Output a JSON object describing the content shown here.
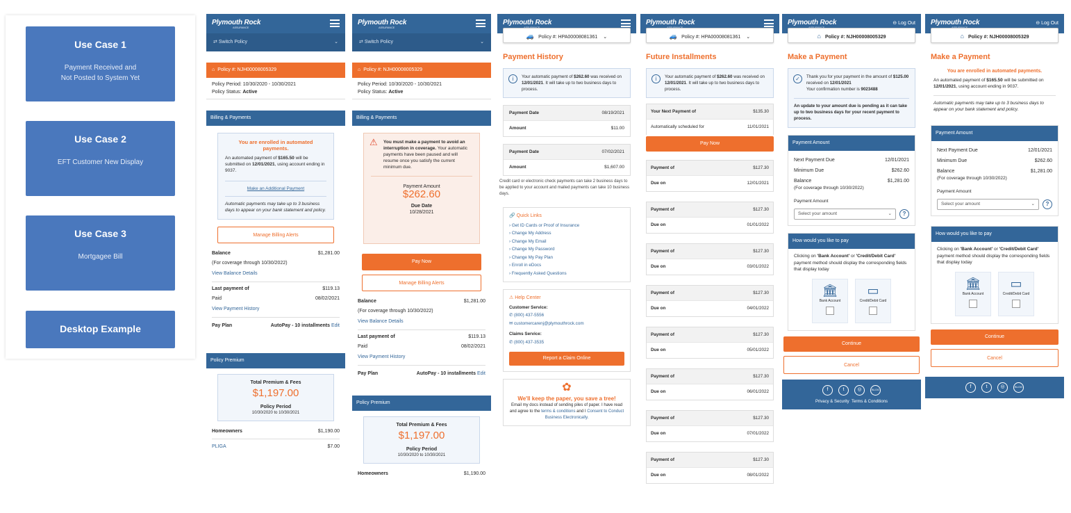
{
  "use_cases": [
    {
      "title": "Use Case 1",
      "desc1": "Payment Received and",
      "desc2": "Not Posted to System Yet"
    },
    {
      "title": "Use Case 2",
      "desc1": "EFT Customer New Display",
      "desc2": ""
    },
    {
      "title": "Use Case 3",
      "desc1": "Mortgagee Bill",
      "desc2": ""
    },
    {
      "title": "Desktop Example",
      "desc1": "",
      "desc2": ""
    }
  ],
  "common": {
    "logo": "Plymouth Rock",
    "logo_sub": "ASSURANCE",
    "switch_policy": "Switch Policy",
    "policy_number": "Policy #: NJH00008005329",
    "policy_period_label": "Policy Period:",
    "policy_period": "10/30/2020 - 10/30/2021",
    "policy_status_label": "Policy Status:",
    "policy_status": "Active",
    "billing_payments": "Billing & Payments",
    "manage_alerts": "Manage Billing Alerts",
    "balance_label": "Balance",
    "balance_value": "$1,281.00",
    "coverage_through": "(For coverage through 10/30/2022)",
    "view_balance": "View Balance Details",
    "last_payment_label": "Last payment of",
    "last_payment_value": "$119.13",
    "paid_label": "Paid",
    "paid_date": "08/02/2021",
    "view_history": "View Payment History",
    "pay_plan_label": "Pay Plan",
    "pay_plan_value": "AutoPay - 10 installments",
    "edit": "Edit",
    "policy_premium": "Policy Premium",
    "total_premium_label": "Total Premium & Fees",
    "total_premium": "$1,197.00",
    "policy_period_title": "Policy Period",
    "policy_period_short": "10/30/2020 to 10/30/2021",
    "homeowners_label": "Homeowners",
    "homeowners_value": "$1,190.00",
    "pliga_label": "PLIGA",
    "pliga_value": "$7.00",
    "log_out": "Log Out",
    "pay_now": "Pay Now"
  },
  "col1": {
    "enrolled_title": "You are enrolled in automated payments.",
    "enrolled_text_a": "An automated payment of",
    "enrolled_amount": "$165.50",
    "enrolled_text_b": "will be submitted on",
    "enrolled_date": "12/01/2021",
    "enrolled_text_c": ", using account ending in 9037.",
    "additional_payment": "Make an Additional Payment",
    "note": "Automatic payments may take up to 3 business days to appear on your bank statement and policy."
  },
  "col2": {
    "warning": "You must make a payment to avoid an interruption in coverage.",
    "warning_rest": "Your automatic payments have been paused and will resume once you satisfy the current minimum due.",
    "payment_amount_label": "Payment Amount",
    "payment_amount": "$262.60",
    "due_date_label": "Due Date",
    "due_date": "10/28/2021"
  },
  "col3": {
    "policy_pill": "Policy #: HPA00008081361",
    "title": "Payment History",
    "info_a": "Your automatic payment of",
    "info_amount": "$262.60",
    "info_b": "was received on",
    "info_date": "12/01/2021",
    "info_c": ". It will take up to two business days to process.",
    "history": [
      {
        "date_label": "Payment Date",
        "date": "08/19/2021",
        "amount_label": "Amount",
        "amount": "$11.00"
      },
      {
        "date_label": "Payment Date",
        "date": "07/02/2021",
        "amount_label": "Amount",
        "amount": "$1,607.00"
      }
    ],
    "note": "Credit card or electronic check payments can take 2 business days to be applied to your account and mailed payments can take 10 business days.",
    "quick_links_title": "Quick Links",
    "quick_links": [
      "Get ID Cards or Proof of Insurance",
      "Change My Address",
      "Change My Email",
      "Change My Password",
      "Change My Pay Plan",
      "Enroll in eDocs",
      "Frequently Asked Questions"
    ],
    "help_title": "Help Center",
    "customer_service": "Customer Service:",
    "cs_phone": "(800) 437-5556",
    "cs_email": "customercarenj@plymouthrock.com",
    "claims_service": "Claims Service:",
    "claims_phone": "(800) 437-3535",
    "report_claim": "Report a Claim Online",
    "tree_title": "We'll keep the paper, you save a tree!",
    "tree_text_a": "Email my docs instead of sending piles of paper. I have read and agree to the",
    "tree_link_1": "terms & conditions",
    "tree_text_b": "and I",
    "tree_link_2": "Consent to Conduct Business Electronically."
  },
  "col4": {
    "policy_pill": "Policy #: HPA00008081361",
    "title": "Future Installments",
    "next_payment_label": "Your Next Payment of",
    "next_payment": "$135.30",
    "auto_scheduled_label": "Automatically scheduled for",
    "auto_scheduled": "11/01/2021",
    "installments": [
      {
        "label": "Payment of",
        "amount": "$127.30",
        "due_label": "Due on",
        "due": "12/01/2021"
      },
      {
        "label": "Payment of",
        "amount": "$127.30",
        "due_label": "Due on",
        "due": "01/01/2022"
      },
      {
        "label": "Payment of",
        "amount": "$127.30",
        "due_label": "Due on",
        "due": "03/01/2022"
      },
      {
        "label": "Payment of",
        "amount": "$127.30",
        "due_label": "Due on",
        "due": "04/01/2022"
      },
      {
        "label": "Payment of",
        "amount": "$127.30",
        "due_label": "Due on",
        "due": "05/01/2022"
      },
      {
        "label": "Payment of",
        "amount": "$127.30",
        "due_label": "Due on",
        "due": "06/01/2022"
      },
      {
        "label": "Payment of",
        "amount": "$127.30",
        "due_label": "Due on",
        "due": "07/01/2022"
      },
      {
        "label": "Payment of",
        "amount": "$127.30",
        "due_label": "Due on",
        "due": "08/01/2022"
      }
    ]
  },
  "col5": {
    "title": "Make a Payment",
    "thanks_a": "Thank you for your payment in the amount of",
    "thanks_amount": "$125.00",
    "thanks_b": "received on",
    "thanks_date": "12/01/2021",
    "confirmation_a": "Your confirmation number is",
    "confirmation": "9023488",
    "pending": "An update to your amount due is pending as it can take up to two business days for your recent payment to process."
  },
  "col6": {
    "title": "Make a Payment",
    "enrolled_title": "You are enrolled in automated payments.",
    "enrolled_text_a": "An automated payment of",
    "enrolled_amount": "$165.50",
    "enrolled_text_b": "will be submitted on",
    "enrolled_date": "12/01/2021",
    "enrolled_text_c": ", using account ending in 9037.",
    "note": "Automatic payments may take up to 3 business days to appear on your bank statement and policy."
  },
  "payment": {
    "section_title": "Payment Amount",
    "next_due_label": "Next Payment Due",
    "next_due": "12/01/2021",
    "min_due_label": "Minimum Due",
    "min_due": "$262.60",
    "balance_label": "Balance",
    "balance": "$1,281.00",
    "coverage": "(For coverage through 10/30/2022)",
    "amount_label": "Payment Amount",
    "select_placeholder": "Select your amount",
    "how_title": "How would you like to pay",
    "how_text_a": "Clicking on",
    "how_bank": "'Bank Account'",
    "how_or": "or",
    "how_card": "'Credit/Debit Card'",
    "how_text_b": "payment method should display the corresponding fields that display today",
    "bank_account": "Bank Account",
    "credit_card": "Credit/Debit Card",
    "continue": "Continue",
    "cancel": "Cancel",
    "privacy": "Privacy & Security",
    "terms": "Terms & Conditions",
    "blog": "BLOG"
  },
  "colors": {
    "brand_blue": "#336699",
    "accent_orange": "#ee6f2d",
    "use_case_blue": "#4a78bd"
  }
}
